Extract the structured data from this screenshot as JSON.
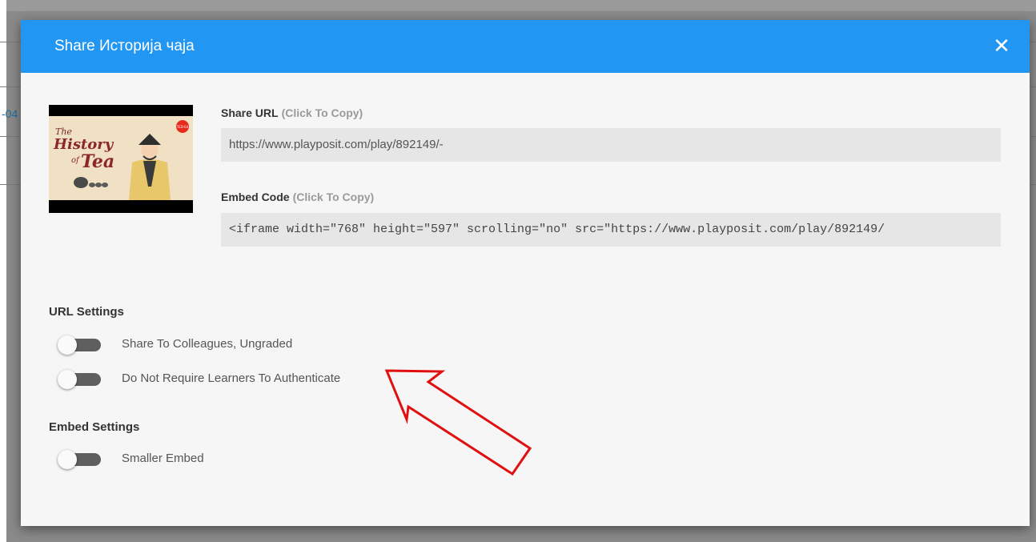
{
  "background": {
    "fragment_text": "-04"
  },
  "modal": {
    "title": "Share Историја чаја",
    "close_symbol": "✕",
    "header_color": "#2196f3",
    "thumbnail": {
      "text_the": "The",
      "text_history": "History",
      "text_of": "of",
      "text_tea": "Tea",
      "badge": "TED-Ed"
    },
    "share_url": {
      "label": "Share URL",
      "hint": "(Click To Copy)",
      "value": "https://www.playposit.com/play/892149/-"
    },
    "embed_code": {
      "label": "Embed Code",
      "hint": "(Click To Copy)",
      "value": "<iframe width=\"768\" height=\"597\" scrolling=\"no\" src=\"https://www.playposit.com/play/892149/"
    },
    "url_settings": {
      "title": "URL Settings",
      "toggles": [
        {
          "label": "Share To Colleagues, Ungraded",
          "on": false
        },
        {
          "label": "Do Not Require Learners To Authenticate",
          "on": false
        }
      ]
    },
    "embed_settings": {
      "title": "Embed Settings",
      "toggles": [
        {
          "label": "Smaller Embed",
          "on": false
        }
      ]
    }
  },
  "annotation": {
    "arrow_color": "#e01010"
  }
}
